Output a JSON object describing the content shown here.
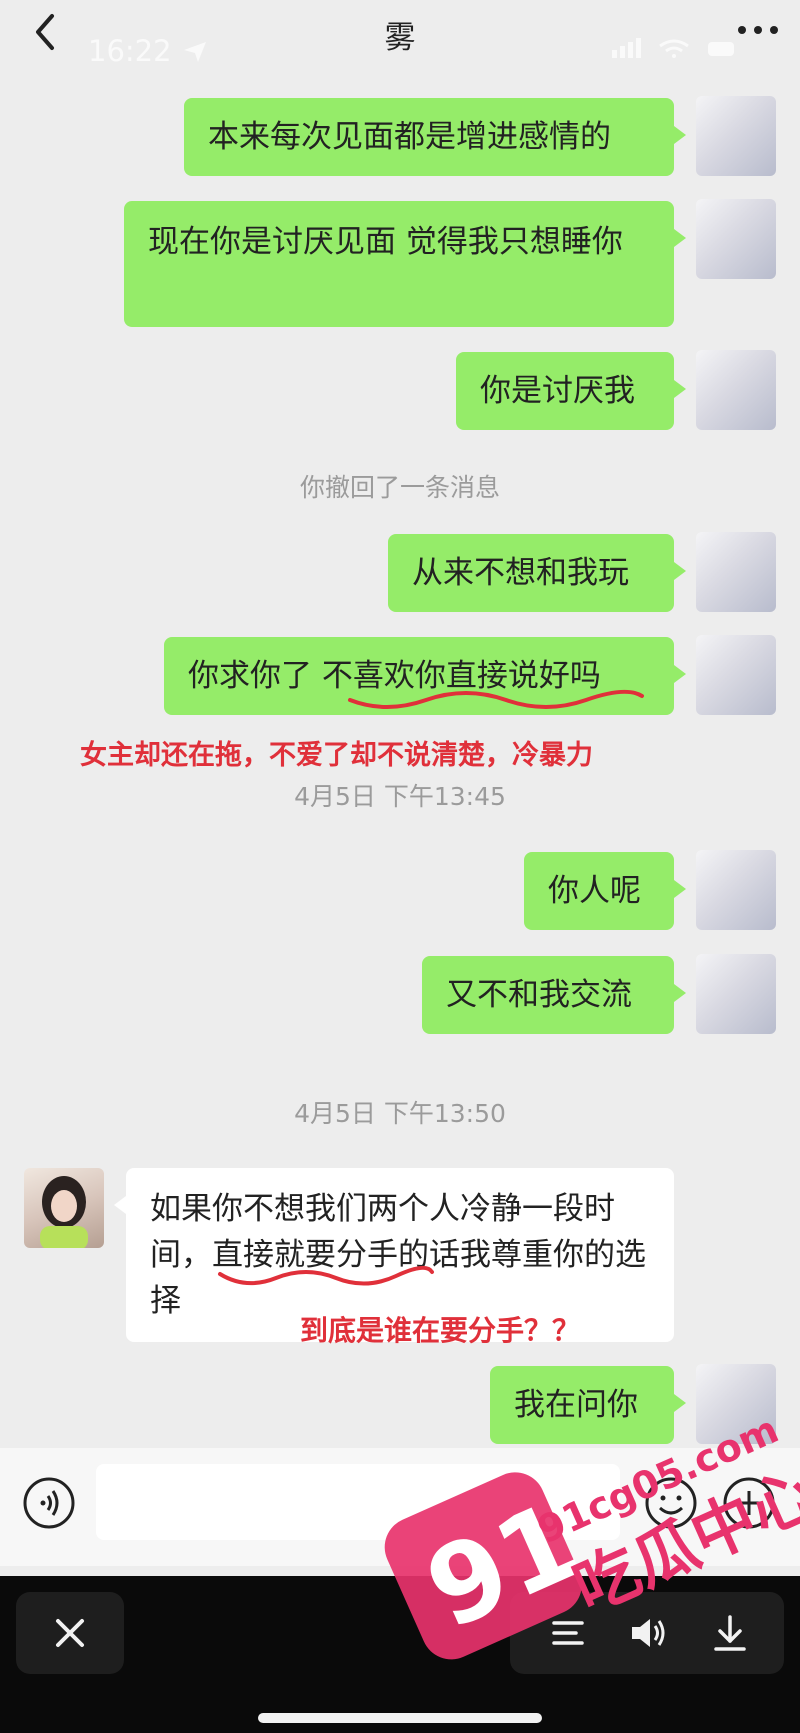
{
  "status_bar": {
    "time": "16:22"
  },
  "header": {
    "title": "雾"
  },
  "messages": [
    {
      "text": "本来每次见面都是增进感情的"
    },
    {
      "text": "现在你是讨厌见面  觉得我只想睡你"
    },
    {
      "text": "你是讨厌我"
    },
    {
      "text": "从来不想和我玩"
    },
    {
      "text": "你求你了  不喜欢你直接说好吗"
    },
    {
      "text": "你人呢"
    },
    {
      "text": "又不和我交流"
    },
    {
      "text": "如果你不想我们两个人冷静一段时间，直接就要分手的话我尊重你的选择"
    },
    {
      "text": "我在问你"
    }
  ],
  "system": {
    "recall": "你撤回了一条消息",
    "time1": "4月5日 下午13:45",
    "time2": "4月5日 下午13:50"
  },
  "annotations": {
    "note1": "女主却还在拖，不爱了却不说清楚，冷暴力",
    "note2": "到底是谁在要分手？？"
  },
  "watermark": {
    "number": "91",
    "site": "91cg05.com",
    "name": "吃瓜中心"
  },
  "colors": {
    "bubble_out": "#95ec69",
    "bubble_in": "#ffffff",
    "annotation": "#e0303a",
    "watermark": "#e8336d"
  },
  "icons": [
    "back-icon",
    "location-arrow-icon",
    "more-icon",
    "voice-icon",
    "emoji-icon",
    "plus-icon",
    "close-icon",
    "menu-icon",
    "speaker-icon",
    "download-icon"
  ]
}
